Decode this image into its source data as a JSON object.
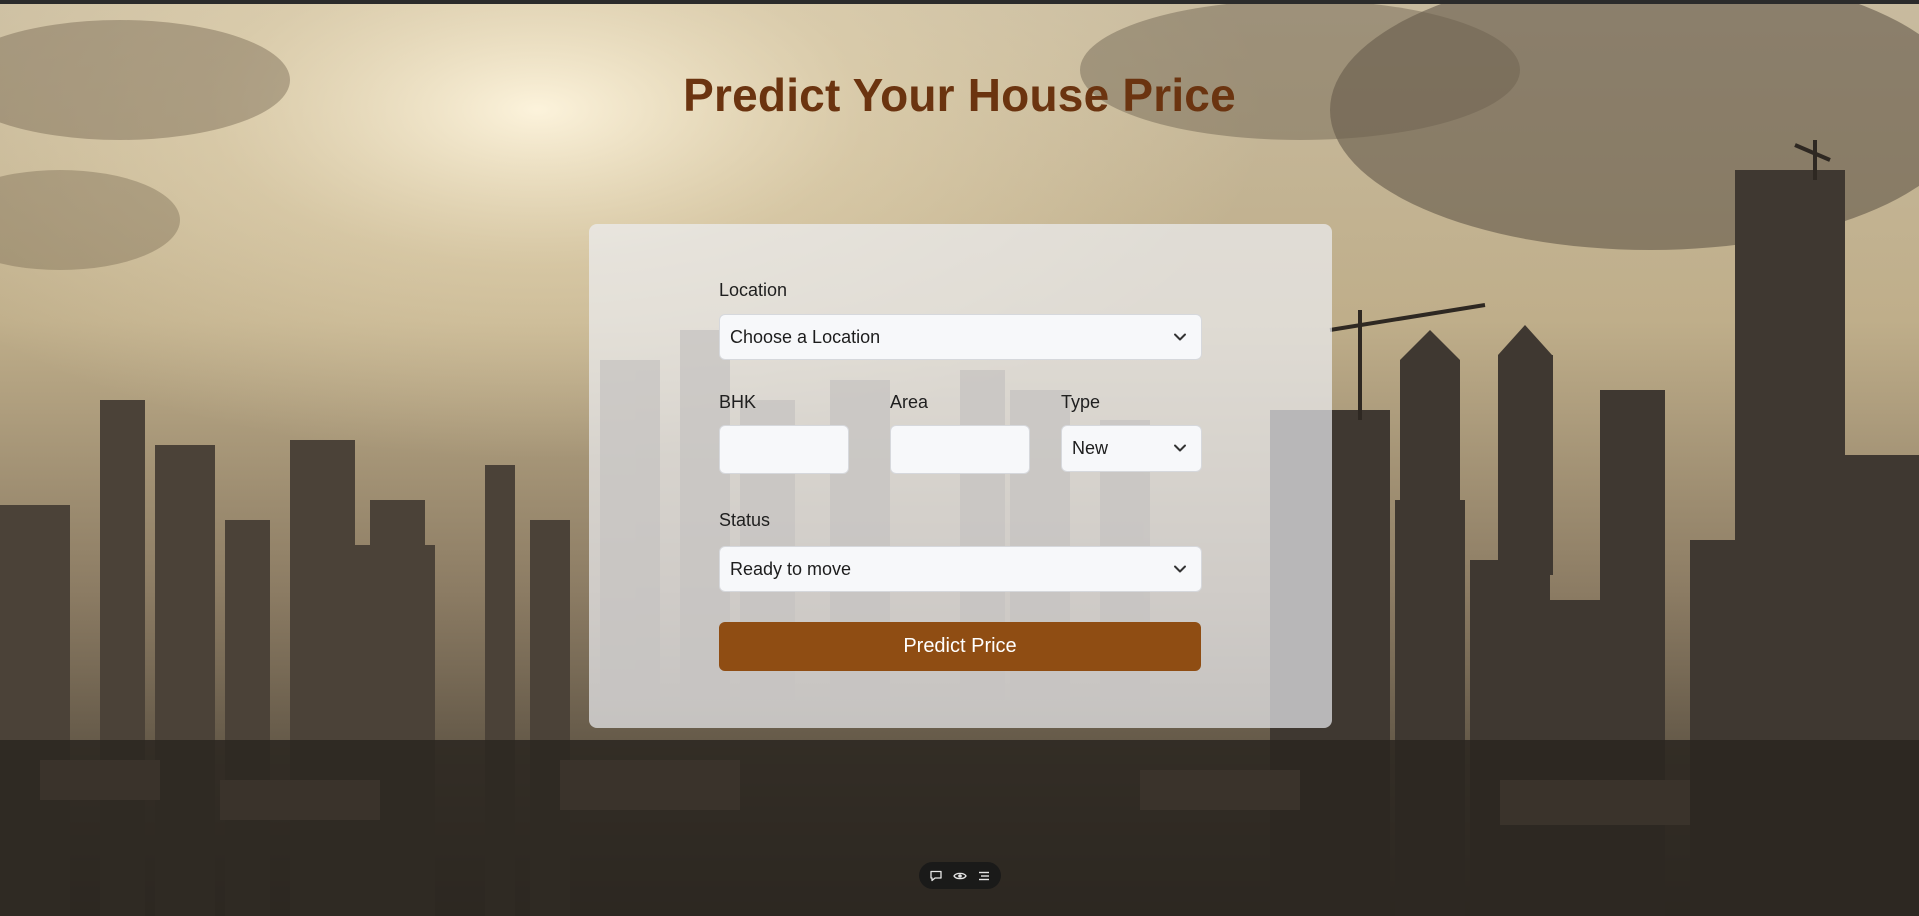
{
  "page": {
    "title": "Predict Your House Price"
  },
  "form": {
    "location": {
      "label": "Location",
      "value": "Choose a Location"
    },
    "bhk": {
      "label": "BHK",
      "value": ""
    },
    "area": {
      "label": "Area",
      "value": ""
    },
    "type": {
      "label": "Type",
      "value": "New"
    },
    "status": {
      "label": "Status",
      "value": "Ready to move"
    },
    "submit_label": "Predict Price"
  },
  "toolbar": {
    "icons": [
      "chat-bubble-icon",
      "eye-icon",
      "list-icon"
    ]
  },
  "colors": {
    "title": "#6b3410",
    "button": "#8f4d13",
    "card": "#eceef2"
  }
}
